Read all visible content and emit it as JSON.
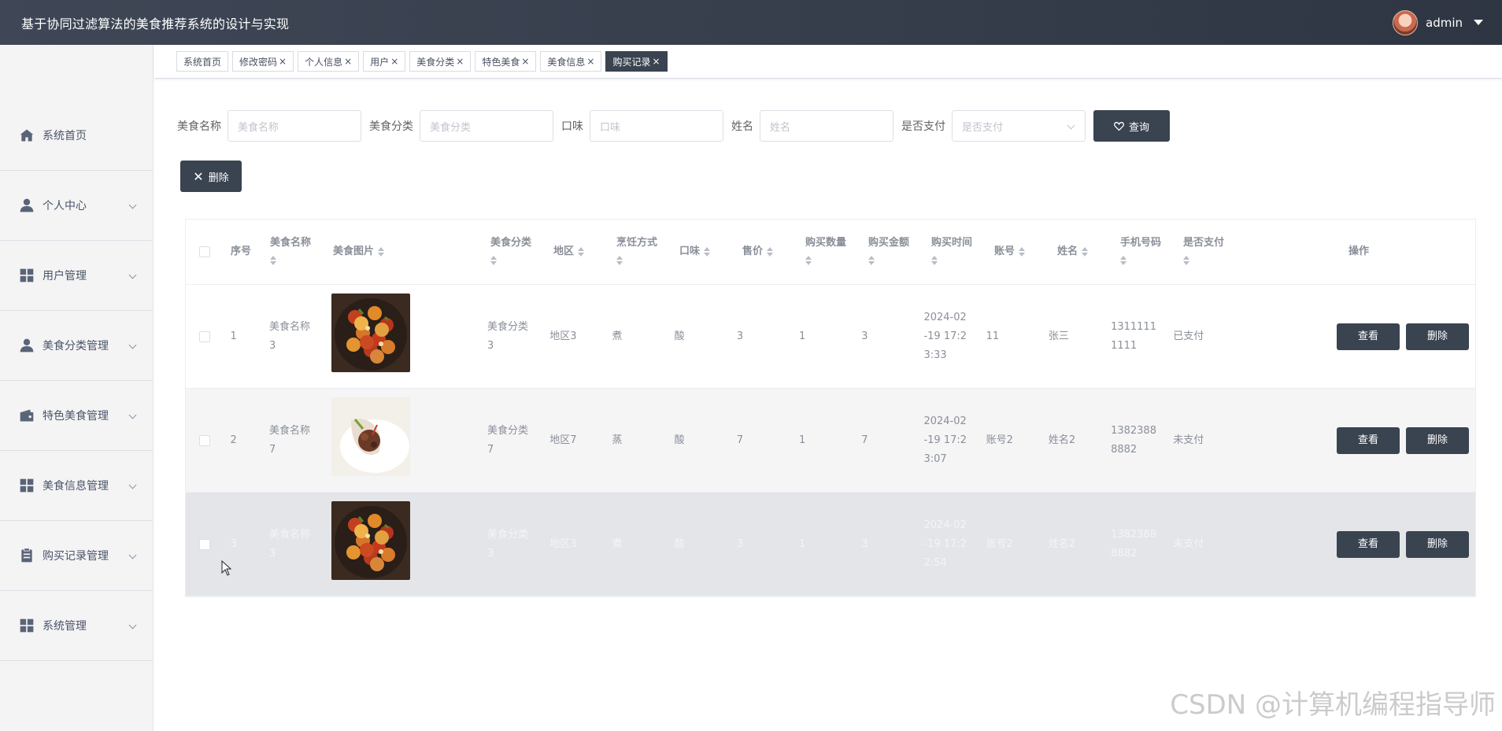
{
  "header": {
    "title": "基于协同过滤算法的美食推荐系统的设计与实现",
    "username": "admin"
  },
  "sidebar": {
    "items": [
      {
        "label": "系统首页",
        "icon": "home-icon",
        "expandable": false
      },
      {
        "label": "个人中心",
        "icon": "user-icon",
        "expandable": true
      },
      {
        "label": "用户管理",
        "icon": "grid-icon",
        "expandable": true
      },
      {
        "label": "美食分类管理",
        "icon": "user-icon",
        "expandable": true
      },
      {
        "label": "特色美食管理",
        "icon": "wallet-icon",
        "expandable": true
      },
      {
        "label": "美食信息管理",
        "icon": "grid-icon",
        "expandable": true
      },
      {
        "label": "购买记录管理",
        "icon": "clipboard-icon",
        "expandable": true
      },
      {
        "label": "系统管理",
        "icon": "grid-icon",
        "expandable": true
      }
    ]
  },
  "tabs": [
    {
      "label": "系统首页",
      "closable": false,
      "active": false
    },
    {
      "label": "修改密码",
      "closable": true,
      "active": false
    },
    {
      "label": "个人信息",
      "closable": true,
      "active": false
    },
    {
      "label": "用户",
      "closable": true,
      "active": false
    },
    {
      "label": "美食分类",
      "closable": true,
      "active": false
    },
    {
      "label": "特色美食",
      "closable": true,
      "active": false
    },
    {
      "label": "美食信息",
      "closable": true,
      "active": false
    },
    {
      "label": "购买记录",
      "closable": true,
      "active": true
    }
  ],
  "search": {
    "food_name_label": "美食名称",
    "food_name_placeholder": "美食名称",
    "category_label": "美食分类",
    "category_placeholder": "美食分类",
    "taste_label": "口味",
    "taste_placeholder": "口味",
    "name_label": "姓名",
    "name_placeholder": "姓名",
    "paid_label": "是否支付",
    "paid_placeholder": "是否支付",
    "query_button": "查询"
  },
  "toolbar": {
    "delete_button": "删除"
  },
  "table": {
    "columns": [
      "序号",
      "美食名称",
      "美食图片",
      "美食分类",
      "地区",
      "烹饪方式",
      "口味",
      "售价",
      "购买数量",
      "购买金额",
      "购买时间",
      "账号",
      "姓名",
      "手机号码",
      "是否支付",
      "操作"
    ],
    "rows": [
      {
        "index": "1",
        "food_name": "美食名称3",
        "image": "fried-dish",
        "category": "美食分类3",
        "region": "地区3",
        "cooking": "煮",
        "taste": "酸",
        "price": "3",
        "quantity": "1",
        "amount": "3",
        "time": "2024-02-19 17:23:33",
        "account": "11",
        "name": "张三",
        "phone": "13111111111",
        "paid": "已支付"
      },
      {
        "index": "2",
        "food_name": "美食名称7",
        "image": "wrap-dish",
        "category": "美食分类7",
        "region": "地区7",
        "cooking": "蒸",
        "taste": "酸",
        "price": "7",
        "quantity": "1",
        "amount": "7",
        "time": "2024-02-19 17:23:07",
        "account": "账号2",
        "name": "姓名2",
        "phone": "13823888882",
        "paid": "未支付"
      },
      {
        "index": "3",
        "food_name": "美食名称3",
        "image": "fried-dish",
        "category": "美食分类3",
        "region": "地区3",
        "cooking": "煮",
        "taste": "酸",
        "price": "3",
        "quantity": "1",
        "amount": "3",
        "time": "2024-02-19 17:22:54",
        "account": "账号2",
        "name": "姓名2",
        "phone": "13823888882",
        "paid": "未支付"
      }
    ],
    "view_button": "查看",
    "delete_button": "删除"
  },
  "watermark": "CSDN @计算机编程指导师",
  "colors": {
    "header_bg": "#2f3643",
    "accent_dark": "#3a4350",
    "sidebar_bg": "#f4f4f5"
  }
}
